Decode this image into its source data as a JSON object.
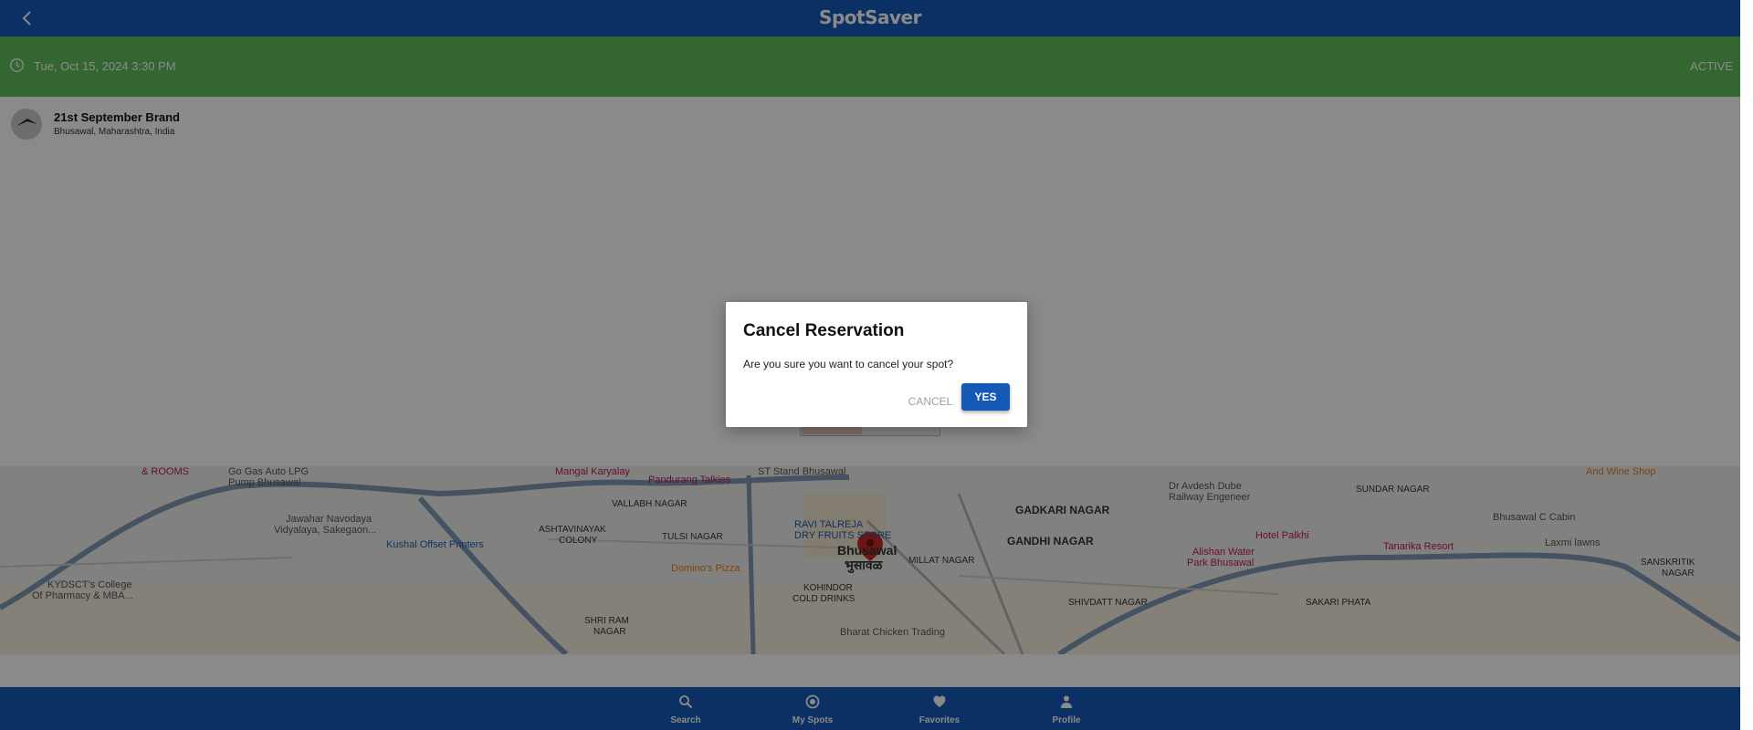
{
  "app": {
    "title": "SpotSaver"
  },
  "colors": {
    "brand_blue": "#1559b7",
    "active_green": "#5fbd5b",
    "overlay": "rgba(0,0,0,0.46)"
  },
  "header": {
    "back_icon": "chevron-left-icon",
    "logo_text": "SpotSaver"
  },
  "reservation": {
    "datetime": "Tue, Oct 15, 2024 3:30 PM",
    "status": "ACTIVE",
    "clock_icon": "clock-icon"
  },
  "spot": {
    "name": "21st September Brand",
    "address": "Bhusawal, Maharashtra, India"
  },
  "map": {
    "labels": [
      "& ROOMS",
      "Go Gas Auto LPG",
      "Pump Bhusawal",
      "Mangal Karyalay",
      "Pandurang Talkies",
      "ST Stand Bhusawal",
      "VALLABH NAGAR",
      "ASHTAVINAYAK",
      "COLONY",
      "TULSI NAGAR",
      "Jawahar Navodaya",
      "Vidyalaya, Sakegaon...",
      "Kushal Offset Printers",
      "KYDSCT's College",
      "Of Pharmacy & MBA...",
      "RAVI TALREJA",
      "DRY FRUITS STORE",
      "Bhusawal",
      "भुसावळ",
      "MILLAT NAGAR",
      "Domino's Pizza",
      "KOHINDOR",
      "COLD DRINKS",
      "Bharat Chicken Trading",
      "SHRI RAM",
      "NAGAR",
      "GADKARI NAGAR",
      "GANDHI NAGAR",
      "SHIVDATT NAGAR",
      "Dr Avdesh Dube",
      "Railway Engeneer",
      "Alishan Water",
      "Park Bhusawal",
      "Hotel Palkhi",
      "SUNDAR NAGAR",
      "Bhusawal C Cabin",
      "Tanarika Resort",
      "Laxmi lawns",
      "And Wine Shop",
      "SAKARI PHATA",
      "SANSKRITIK",
      "NAGAR"
    ]
  },
  "nav": {
    "items": [
      {
        "label": "Search",
        "icon": "search-icon"
      },
      {
        "label": "My Spots",
        "icon": "target-icon"
      },
      {
        "label": "Favorites",
        "icon": "heart-icon"
      },
      {
        "label": "Profile",
        "icon": "person-icon"
      }
    ]
  },
  "dialog": {
    "title": "Cancel Reservation",
    "message": "Are you sure you want to cancel your spot?",
    "cancel_label": "CANCEL",
    "confirm_label": "YES"
  }
}
